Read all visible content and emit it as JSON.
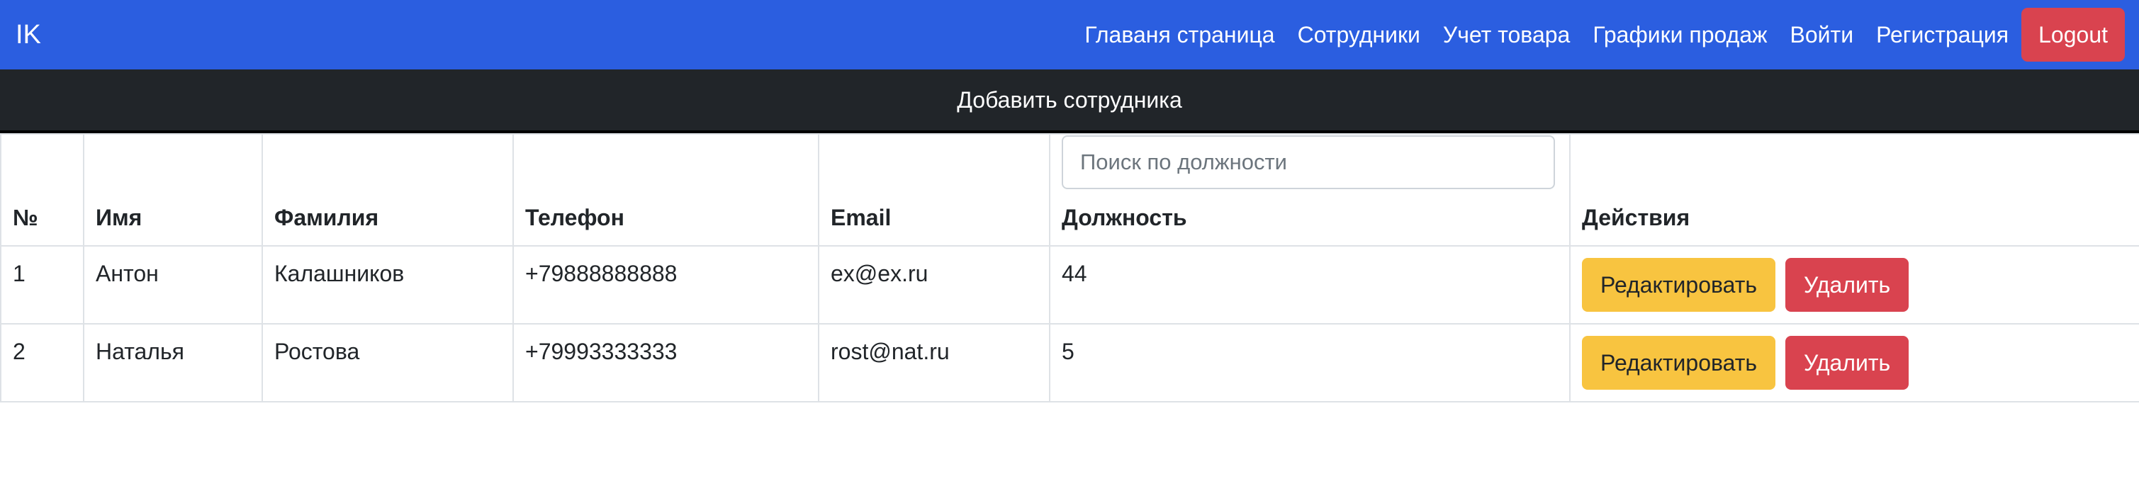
{
  "navbar": {
    "brand": "IK",
    "links": [
      "Главаня страница",
      "Сотрудники",
      "Учет товара",
      "Графики продаж",
      "Войти",
      "Регистрация"
    ],
    "logout_label": "Logout"
  },
  "add_employee_label": "Добавить сотрудника",
  "table": {
    "headers": {
      "num": "№",
      "first_name": "Имя",
      "last_name": "Фамилия",
      "phone": "Телефон",
      "email": "Email",
      "position": "Должность",
      "actions": "Действия"
    },
    "search_placeholder": "Поиск по должности",
    "rows": [
      {
        "num": "1",
        "first_name": "Антон",
        "last_name": "Калашников",
        "phone": "+79888888888",
        "email": "ex@ex.ru",
        "position": "44"
      },
      {
        "num": "2",
        "first_name": "Наталья",
        "last_name": "Ростова",
        "phone": "+79993333333",
        "email": "rost@nat.ru",
        "position": "5"
      }
    ],
    "edit_label": "Редактировать",
    "delete_label": "Удалить"
  }
}
